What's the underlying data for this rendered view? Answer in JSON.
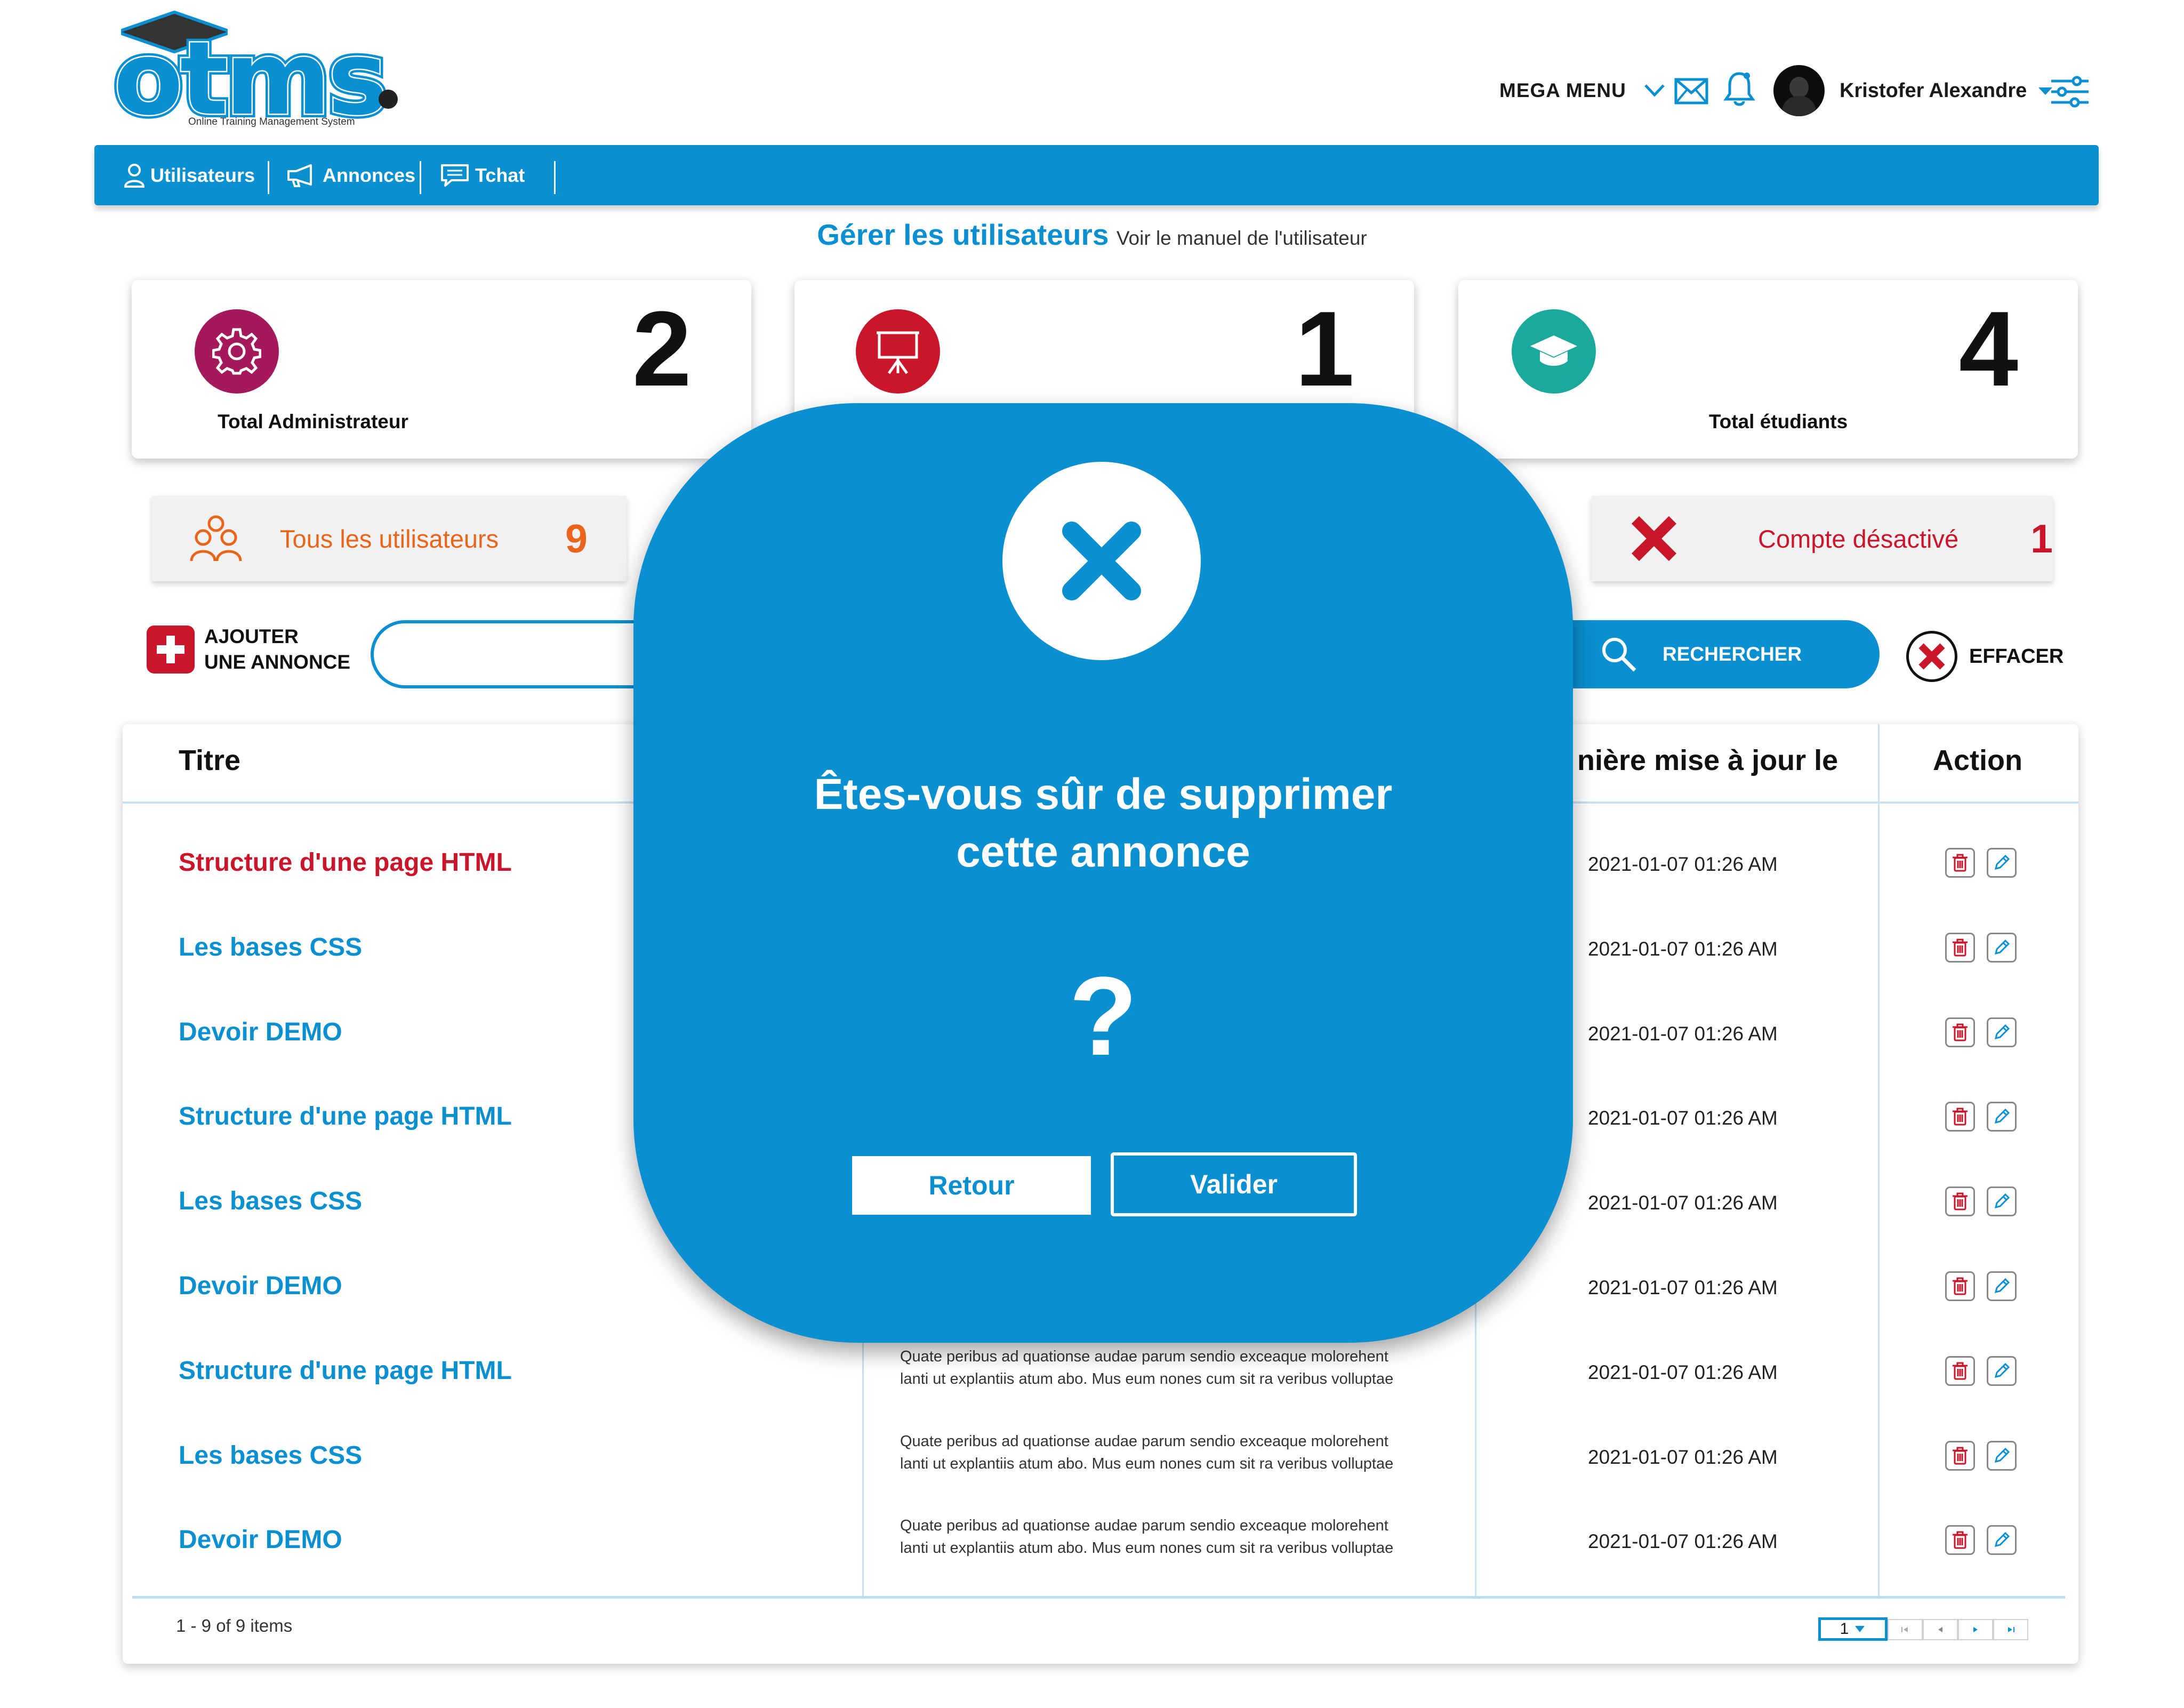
{
  "logo": {
    "word": "otms",
    "tagline": "Online Training Management System"
  },
  "header": {
    "mega_menu": "MEGA MENU",
    "user_name": "Kristofer Alexandre"
  },
  "nav": {
    "items": [
      {
        "label": "Utilisateurs",
        "icon": "user-icon"
      },
      {
        "label": "Annonces",
        "icon": "megaphone-icon"
      },
      {
        "label": "Tchat",
        "icon": "chat-icon"
      }
    ]
  },
  "page": {
    "title": "Gérer les utilisateurs",
    "manual_link": "Voir le manuel de l'utilisateur"
  },
  "stats": [
    {
      "label": "Total Administrateur",
      "value": "2",
      "color": "#a3195b",
      "icon": "gear-icon"
    },
    {
      "label": "",
      "value": "1",
      "color": "#c9162b",
      "icon": "presentation-board-icon"
    },
    {
      "label": "Total étudiants",
      "value": "4",
      "color": "#1aa99b",
      "icon": "graduation-cap-icon"
    }
  ],
  "filters": {
    "all_users": {
      "label": "Tous les utilisateurs",
      "count": "9",
      "color": "#e8651a"
    },
    "disabled": {
      "label": "Compte désactivé",
      "count": "1",
      "color": "#c9162b"
    }
  },
  "toolbar": {
    "add_line1": "AJOUTER",
    "add_line2": "UNE ANNONCE",
    "search_value": "",
    "search_button": "RECHERCHER",
    "clear_button": "EFFACER"
  },
  "table": {
    "headers": {
      "title": "Titre",
      "updated": "nière mise à jour le",
      "action": "Action"
    },
    "rows": [
      {
        "title": "Structure d'une page HTML",
        "date": "2021-01-07 01:26 AM",
        "desc1": "",
        "desc2": ""
      },
      {
        "title": "Les bases CSS",
        "date": "2021-01-07 01:26 AM",
        "desc1": "",
        "desc2": ""
      },
      {
        "title": "Devoir DEMO",
        "date": "2021-01-07 01:26 AM",
        "desc1": "",
        "desc2": ""
      },
      {
        "title": "Structure d'une page HTML",
        "date": "2021-01-07 01:26 AM",
        "desc1": "",
        "desc2": ""
      },
      {
        "title": "Les bases CSS",
        "date": "2021-01-07 01:26 AM",
        "desc1": "",
        "desc2": ""
      },
      {
        "title": "Devoir DEMO",
        "date": "2021-01-07 01:26 AM",
        "desc1": "",
        "desc2": ""
      },
      {
        "title": "Structure d'une page HTML",
        "date": "2021-01-07 01:26 AM",
        "desc1": "Quate peribus ad quationse audae parum sendio exceaque molorehent",
        "desc2": "lanti ut explantiis atum abo. Mus eum nones cum sit ra veribus volluptae"
      },
      {
        "title": "Les bases CSS",
        "date": "2021-01-07 01:26 AM",
        "desc1": "Quate peribus ad quationse audae parum sendio exceaque molorehent",
        "desc2": "lanti ut explantiis atum abo. Mus eum nones cum sit ra veribus volluptae"
      },
      {
        "title": "Devoir DEMO",
        "date": "2021-01-07 01:26 AM",
        "desc1": "Quate peribus ad quationse audae parum sendio exceaque molorehent",
        "desc2": "lanti ut explantiis atum abo. Mus eum nones cum sit ra veribus volluptae"
      }
    ],
    "highlight_color": "#c9162b",
    "title_color": "#0a8fd0",
    "footer_count": "1 - 9 of 9 items",
    "page_select": "1"
  },
  "modal": {
    "line1": "Êtes-vous sûr de supprimer",
    "line2": "cette annonce",
    "question_mark": "?",
    "back_button": "Retour",
    "confirm_button": "Valider",
    "icon": "close-icon"
  },
  "colors": {
    "brand_blue": "#0a8fd0",
    "danger_red": "#c9162b"
  }
}
